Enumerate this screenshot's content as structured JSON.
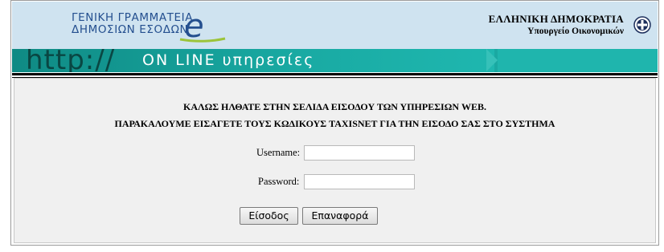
{
  "header": {
    "org_line1": "ΓΕΝΙΚΗ ΓΡΑΜΜΑΤΕΙΑ",
    "org_line2": "ΔΗΜΟΣΙΩΝ ΕΣΟΔΩΝ",
    "logo_letter": "e",
    "state_line1": "ΕΛΛΗΝΙΚΗ ΔΗΜΟΚΡΑΤΙΑ",
    "state_line2": "Υπουργείο Οικονομικών",
    "emblem_icon": "greek-state-emblem-icon"
  },
  "banner": {
    "http_text": "http://",
    "online_text": "ON LINE υπηρεσίες"
  },
  "login": {
    "welcome_line1": "ΚΑΛΩΣ ΗΛΘΑΤΕ ΣΤΗΝ ΣΕΛΙΔΑ ΕΙΣΟΔΟΥ ΤΩΝ ΥΠΗΡΕΣΙΩΝ WEB.",
    "welcome_line2": "ΠΑΡΑΚΑΛΟΥΜΕ ΕΙΣΑΓΕΤΕ ΤΟΥΣ ΚΩΔΙΚΟΥΣ TAXISNET ΓΙΑ ΤΗΝ ΕΙΣΟΔΟ ΣΑΣ ΣΤΟ ΣΥΣΤΗΜΑ",
    "username_label": "Username:",
    "username_value": "",
    "password_label": "Password:",
    "password_value": "",
    "login_button": "Είσοδος",
    "reset_button": "Επαναφορά"
  },
  "colors": {
    "header_bg": "#cfe3f0",
    "org_text": "#244f8f",
    "banner_teal": "#1aa9a2",
    "panel_bg": "#f0f0f0"
  }
}
